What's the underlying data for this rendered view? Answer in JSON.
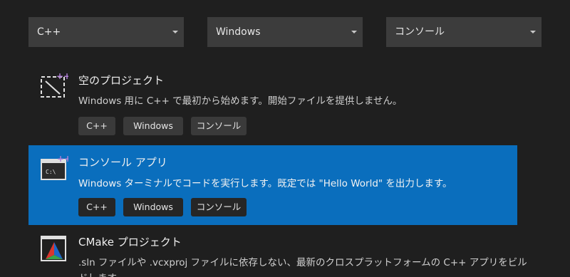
{
  "filters": {
    "language": "C++",
    "platform": "Windows",
    "project_type": "コンソール"
  },
  "templates": [
    {
      "title": "空のプロジェクト",
      "description": "Windows 用に C++ で最初から始めます。開始ファイルを提供しません。",
      "tags": [
        "C++",
        "Windows",
        "コンソール"
      ],
      "icon": "empty-project-icon"
    },
    {
      "title": "コンソール アプリ",
      "description": "Windows ターミナルでコードを実行します。既定では \"Hello World\" を出力します。",
      "tags": [
        "C++",
        "Windows",
        "コンソール"
      ],
      "icon": "console-app-icon"
    },
    {
      "title": "CMake プロジェクト",
      "description": ".sln ファイルや .vcxproj ファイルに依存しない、最新のクロスプラットフォームの C++ アプリをビルドします。",
      "icon": "cmake-icon"
    }
  ],
  "colors": {
    "background": "#1f1f1f",
    "dropdown": "#3c3c3c",
    "selected": "#0a6ebd",
    "tag": "#3a3a3a",
    "accent_plus": "#b180d7"
  }
}
